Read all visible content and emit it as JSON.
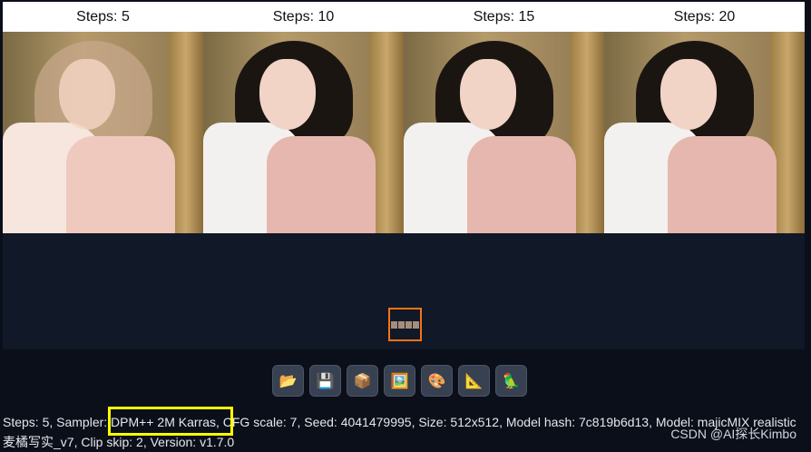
{
  "grid": {
    "headers": [
      "Steps: 5",
      "Steps: 10",
      "Steps: 15",
      "Steps: 20"
    ]
  },
  "toolbar": {
    "buttons": [
      {
        "name": "open-folder-button",
        "icon": "folder-icon",
        "glyph": "📂"
      },
      {
        "name": "save-button",
        "icon": "floppy-disk-icon",
        "glyph": "💾"
      },
      {
        "name": "zip-button",
        "icon": "package-icon",
        "glyph": "📦"
      },
      {
        "name": "send-to-img2img-button",
        "icon": "framed-picture-icon",
        "glyph": "🖼️"
      },
      {
        "name": "send-to-inpaint-button",
        "icon": "palette-icon",
        "glyph": "🎨"
      },
      {
        "name": "send-to-extras-button",
        "icon": "triangular-ruler-icon",
        "glyph": "📐"
      },
      {
        "name": "send-to-parrot-button",
        "icon": "parrot-icon",
        "glyph": "🦜"
      }
    ]
  },
  "info": {
    "text": "Steps: 5, Sampler: DPM++ 2M Karras, CFG scale: 7, Seed: 4041479995, Size: 512x512, Model hash: 7c819b6d13, Model: majicMIX realistic 麦橘写实_v7, Clip skip: 2, Version: v1.7.0"
  },
  "watermark": "CSDN @AI探长Kimbo",
  "colors": {
    "highlight": "#ffff00",
    "thumb_border": "#f97316",
    "background": "#0b0f19"
  }
}
